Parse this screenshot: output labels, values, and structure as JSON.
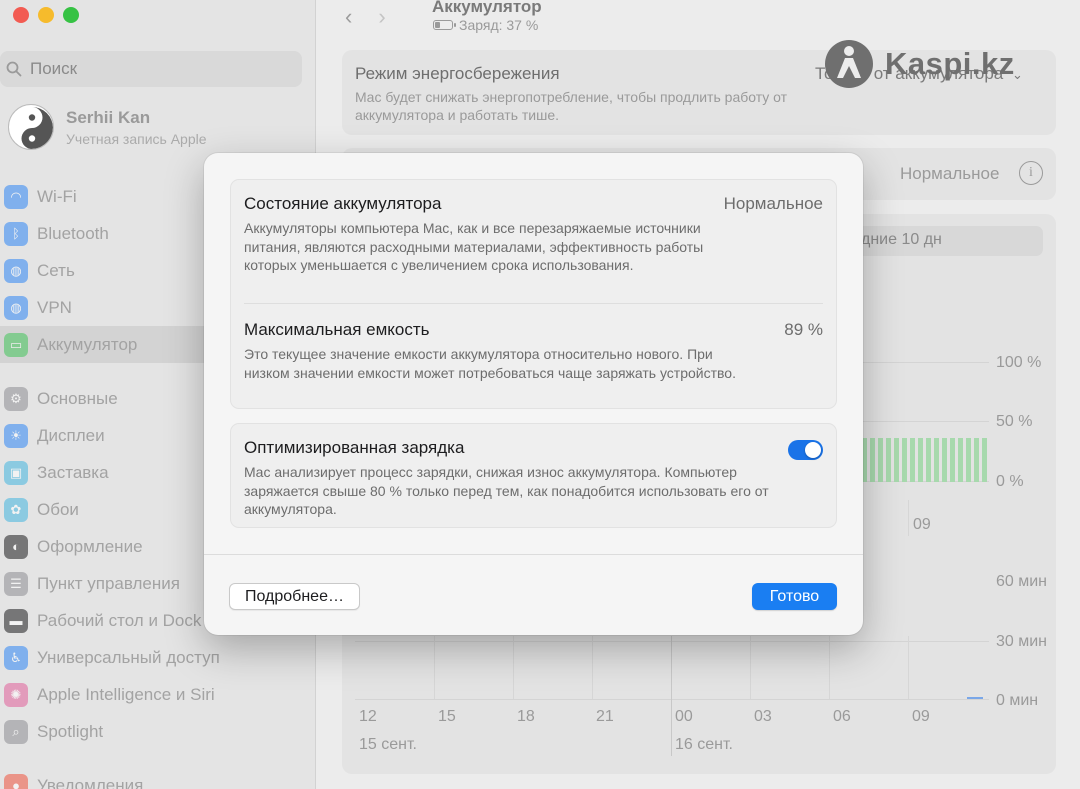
{
  "sidebar": {
    "search_placeholder": "Поиск",
    "account": {
      "name": "Serhii Kan",
      "subtitle": "Учетная запись Apple"
    },
    "items": [
      {
        "label": "Wi-Fi",
        "icon": "wifi-icon",
        "color": "#2f87f5"
      },
      {
        "label": "Bluetooth",
        "icon": "bluetooth-icon",
        "color": "#2f87f5"
      },
      {
        "label": "Сеть",
        "icon": "globe-icon",
        "color": "#2f87f5"
      },
      {
        "label": "VPN",
        "icon": "vpn-globe-icon",
        "color": "#2f87f5"
      },
      {
        "label": "Аккумулятор",
        "icon": "battery-icon",
        "color": "#43c55b",
        "active": true
      },
      {
        "label": "Основные",
        "icon": "gear-icon",
        "color": "#8e8e93"
      },
      {
        "label": "Дисплеи",
        "icon": "sun-icon",
        "color": "#2f87f5"
      },
      {
        "label": "Заставка",
        "icon": "screensaver-icon",
        "color": "#43b6e0"
      },
      {
        "label": "Обои",
        "icon": "flower-icon",
        "color": "#43b6e0"
      },
      {
        "label": "Оформление",
        "icon": "appearance-icon",
        "color": "#1d1d1f"
      },
      {
        "label": "Пункт управления",
        "icon": "control-center-icon",
        "color": "#8e8e93"
      },
      {
        "label": "Рабочий стол и Dock",
        "icon": "dock-icon",
        "color": "#1d1d1f"
      },
      {
        "label": "Универсальный доступ",
        "icon": "accessibility-icon",
        "color": "#2f87f5"
      },
      {
        "label": "Apple Intelligence и Siri",
        "icon": "siri-icon",
        "color": "#e2609a"
      },
      {
        "label": "Spotlight",
        "icon": "spotlight-icon",
        "color": "#8e8e93"
      },
      {
        "label": "Уведомления",
        "icon": "notifications-icon",
        "color": "#f0533e"
      }
    ]
  },
  "main": {
    "title": "Аккумулятор",
    "subtitle": "Заряд: 37 %",
    "energy_saving": {
      "title": "Режим энергосбережения",
      "description": "Mac будет снижать энергопотребление, чтобы продлить работу от аккумулятора и работать тише.",
      "value": "Только от аккумулятора"
    },
    "health_value": "Нормальное",
    "period_label": "дние 10 дн",
    "chart": {
      "y_labels_level": [
        "100 %",
        "50 %",
        "0 %"
      ],
      "y_labels_time": [
        "60 мин",
        "30 мин",
        "0 мин"
      ],
      "x_labels": [
        "12",
        "15",
        "18",
        "21",
        "00",
        "03",
        "06",
        "09"
      ],
      "x_label_upper": "09",
      "dates": [
        "15 сент.",
        "16 сент."
      ]
    }
  },
  "watermark": {
    "text": "Kaspi.kz"
  },
  "modal": {
    "battery_condition": {
      "title": "Состояние аккумулятора",
      "value": "Нормальное",
      "description": "Аккумуляторы компьютера Mac, как и все перезаряжаемые источники питания, являются расходными материалами, эффективность работы которых уменьшается с увеличением срока использования."
    },
    "max_capacity": {
      "title": "Максимальная емкость",
      "value": "89 %",
      "description": "Это текущее значение емкости аккумулятора относительно нового. При низком значении емкости может потребоваться чаще заряжать устройство."
    },
    "optimized_charging": {
      "title": "Оптимизированная зарядка",
      "enabled": true,
      "description": "Mac анализирует процесс зарядки, снижая износ аккумулятора. Компьютер заряжается свыше 80 % только перед тем, как понадобится использовать его от аккумулятора."
    },
    "more_button": "Подробнее…",
    "done_button": "Готово"
  }
}
